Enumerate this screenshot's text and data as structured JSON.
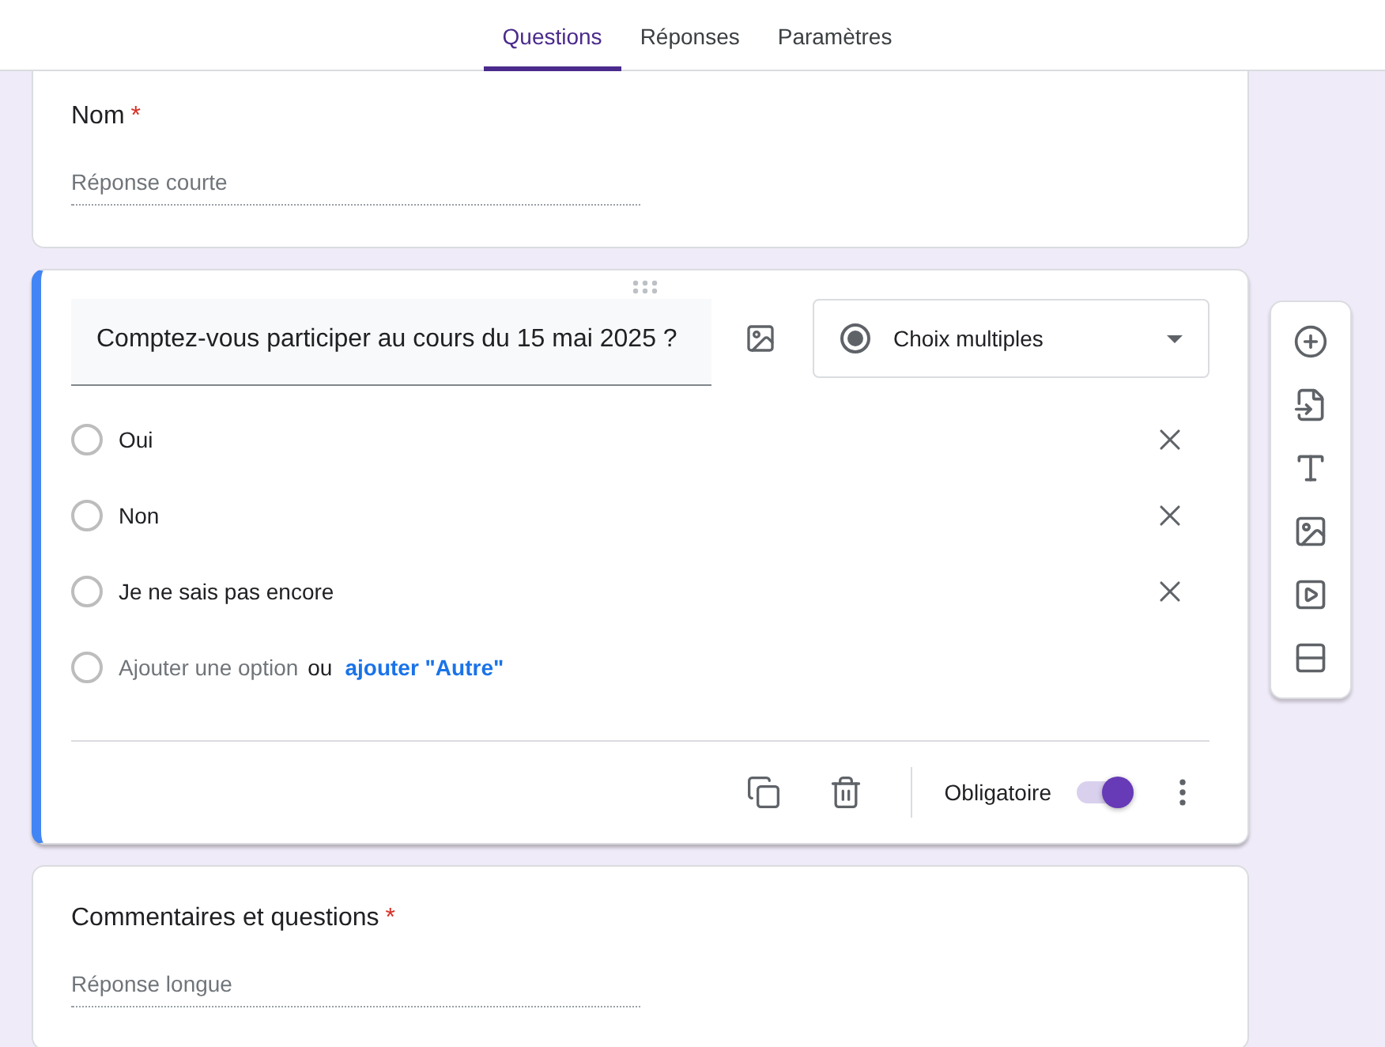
{
  "tabs": [
    {
      "label": "Questions",
      "selected": true
    },
    {
      "label": "Réponses",
      "selected": false
    },
    {
      "label": "Paramètres",
      "selected": false
    }
  ],
  "questions": [
    {
      "kind": "text",
      "title": "Nom",
      "required": true,
      "required_mark": "*",
      "placeholder": "Réponse courte",
      "active": false
    },
    {
      "kind": "choice",
      "title": "Comptez-vous participer au cours du 15 mai 2025 ?",
      "active": true,
      "type_label": "Choix multiples",
      "required_label": "Obligatoire",
      "required": true,
      "options": [
        {
          "kind": "option",
          "label": "Oui"
        },
        {
          "kind": "option",
          "label": "Non"
        },
        {
          "kind": "option",
          "label": "Je ne sais pas encore"
        },
        {
          "kind": "add",
          "label": "Ajouter une option",
          "joiner": "ou",
          "link": "ajouter \"Autre\""
        }
      ]
    },
    {
      "kind": "text",
      "title": "Commentaires et questions",
      "required": true,
      "required_mark": "*",
      "placeholder": "Réponse longue",
      "active": false
    }
  ]
}
